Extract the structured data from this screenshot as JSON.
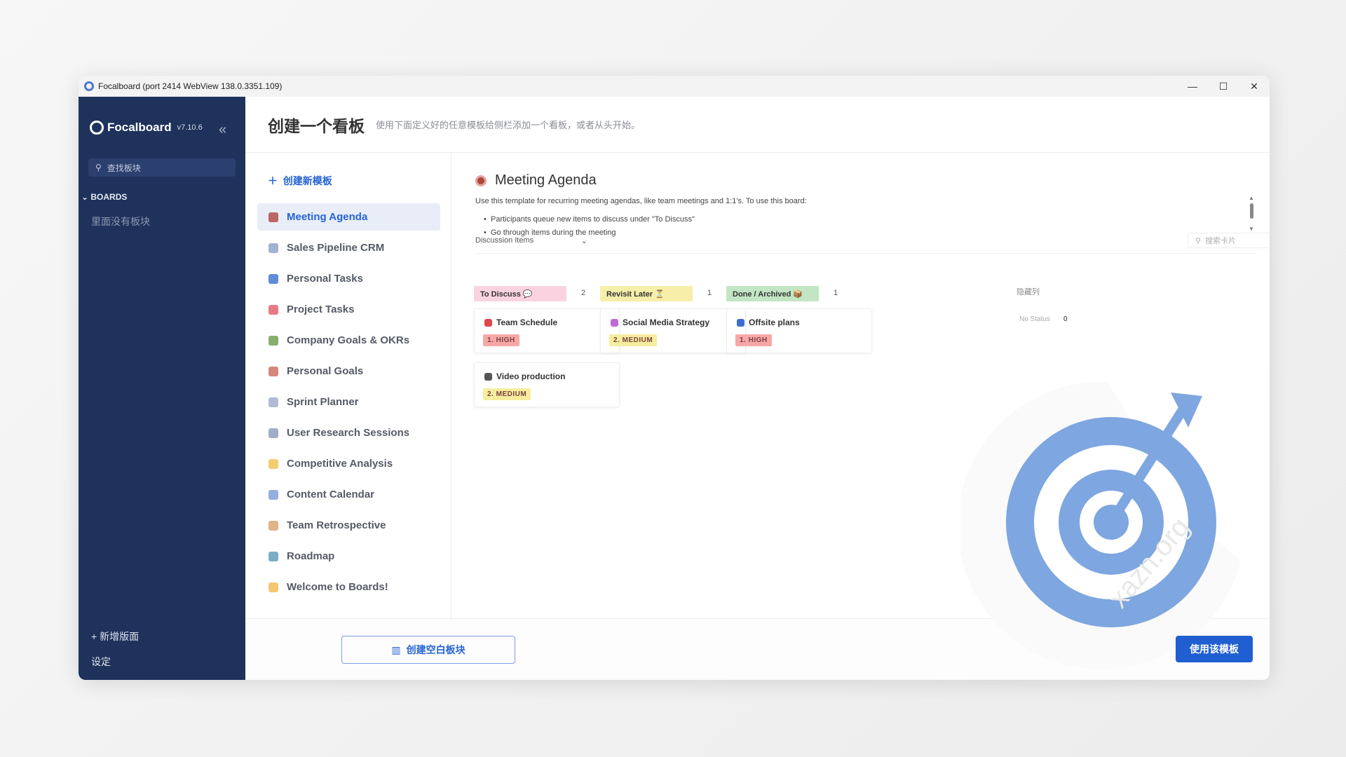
{
  "window": {
    "title": "Focalboard (port 2414 WebView 138.0.3351.109)",
    "minimize": "—",
    "maximize": "☐",
    "close": "✕"
  },
  "sidebar": {
    "brand": "Focalboard",
    "version": "v7.10.6",
    "collapse": "«",
    "search_placeholder": "查找板块",
    "boards_label": "BOARDS",
    "empty": "里面没有板块",
    "add_board": "+ 新增版面",
    "settings": "设定"
  },
  "header": {
    "title": "创建一个看板",
    "subtitle": "使用下面定义好的任意模板给侧栏添加一个看板，或者从头开始。"
  },
  "templates": {
    "new_label": "创建新模板",
    "items": [
      {
        "label": "Meeting Agenda",
        "color": "#b0443f"
      },
      {
        "label": "Sales Pipeline CRM",
        "color": "#8aa0c8"
      },
      {
        "label": "Personal Tasks",
        "color": "#3a6fd1"
      },
      {
        "label": "Project Tasks",
        "color": "#e05a6a"
      },
      {
        "label": "Company Goals & OKRs",
        "color": "#6a9a4a"
      },
      {
        "label": "Personal Goals",
        "color": "#c96a5a"
      },
      {
        "label": "Sprint Planner",
        "color": "#9aaac8"
      },
      {
        "label": "User Research Sessions",
        "color": "#8a9ab8"
      },
      {
        "label": "Competitive Analysis",
        "color": "#f2c14e"
      },
      {
        "label": "Content Calendar",
        "color": "#7a9ad8"
      },
      {
        "label": "Team Retrospective",
        "color": "#d8a06a"
      },
      {
        "label": "Roadmap",
        "color": "#5a9ab8"
      },
      {
        "label": "Welcome to Boards!",
        "color": "#f2b84e"
      }
    ]
  },
  "preview": {
    "title": "Meeting Agenda",
    "description": "Use this template for recurring meeting agendas, like team meetings and 1:1's. To use this board:",
    "bullets": [
      "Participants queue new items to discuss under \"To Discuss\"",
      "Go through items during the meeting"
    ],
    "view": "Discussion Items",
    "search_placeholder": "搜索卡片",
    "more": "···",
    "hidden_columns": "隐藏列",
    "no_status": "No Status",
    "no_status_count": "0",
    "columns": [
      {
        "label": "To Discuss 💬",
        "count": "2",
        "color": "#fbd3e0",
        "cards": [
          {
            "title": "Team Schedule",
            "badge": "1. HIGH",
            "badge_color": "#f8a7a7",
            "icon_color": "#e0474c"
          },
          {
            "title": "Video production",
            "badge": "2. MEDIUM",
            "badge_color": "#f6ee9e",
            "icon_color": "#555"
          }
        ]
      },
      {
        "label": "Revisit Later ⏳",
        "count": "1",
        "color": "#f7efa9",
        "cards": [
          {
            "title": "Social Media Strategy",
            "badge": "2. MEDIUM",
            "badge_color": "#f6ee9e",
            "icon_color": "#c06ad8"
          }
        ]
      },
      {
        "label": "Done / Archived 📦",
        "count": "1",
        "color": "#c2e6c4",
        "cards": [
          {
            "title": "Offsite plans",
            "badge": "1. HIGH",
            "badge_color": "#f8a7a7",
            "icon_color": "#3a6fd1"
          }
        ]
      }
    ]
  },
  "bottom": {
    "blank_board": "创建空白板块",
    "use_template": "使用该模板"
  },
  "watermark": "xazn.org"
}
